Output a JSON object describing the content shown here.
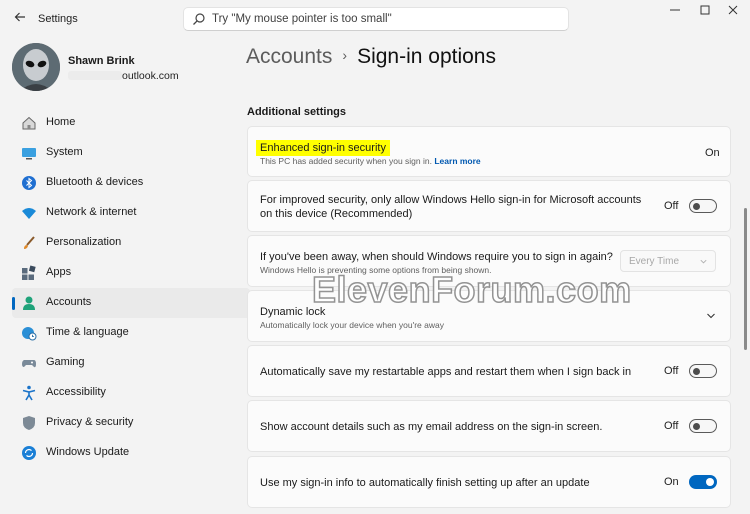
{
  "app": {
    "title": "Settings",
    "search_placeholder": "Try \"My mouse pointer is too small\"",
    "window_controls": [
      "minimize",
      "maximize",
      "close"
    ]
  },
  "profile": {
    "name": "Shawn Brink",
    "email_suffix": "outlook.com"
  },
  "nav": {
    "items": [
      {
        "label": "Home",
        "icon": "home-icon",
        "active": false
      },
      {
        "label": "System",
        "icon": "system-icon",
        "active": false
      },
      {
        "label": "Bluetooth & devices",
        "icon": "bluetooth-icon",
        "active": false
      },
      {
        "label": "Network & internet",
        "icon": "wifi-icon",
        "active": false
      },
      {
        "label": "Personalization",
        "icon": "brush-icon",
        "active": false
      },
      {
        "label": "Apps",
        "icon": "apps-icon",
        "active": false
      },
      {
        "label": "Accounts",
        "icon": "accounts-icon",
        "active": true
      },
      {
        "label": "Time & language",
        "icon": "globe-clock-icon",
        "active": false
      },
      {
        "label": "Gaming",
        "icon": "gamepad-icon",
        "active": false
      },
      {
        "label": "Accessibility",
        "icon": "accessibility-icon",
        "active": false
      },
      {
        "label": "Privacy & security",
        "icon": "shield-icon",
        "active": false
      },
      {
        "label": "Windows Update",
        "icon": "update-icon",
        "active": false
      }
    ]
  },
  "breadcrumb": {
    "parent": "Accounts",
    "separator": "›",
    "current": "Sign-in options"
  },
  "section": {
    "heading": "Additional settings"
  },
  "settings": {
    "enhanced": {
      "title": "Enhanced sign-in security",
      "subtitle": "This PC has added security when you sign in.",
      "link": "Learn more",
      "state": "On"
    },
    "hello_only": {
      "title": "For improved security, only allow Windows Hello sign-in for Microsoft accounts on this device (Recommended)",
      "state": "Off",
      "toggle_on": false
    },
    "away": {
      "title": "If you've been away, when should Windows require you to sign in again?",
      "subtitle": "Windows Hello is preventing some options from being shown.",
      "dropdown_value": "Every Time"
    },
    "dynamic_lock": {
      "title": "Dynamic lock",
      "subtitle": "Automatically lock your device when you're away"
    },
    "restart_apps": {
      "title": "Automatically save my restartable apps and restart them when I sign back in",
      "state": "Off",
      "toggle_on": false
    },
    "account_details": {
      "title": "Show account details such as my email address on the sign-in screen.",
      "state": "Off",
      "toggle_on": false
    },
    "signin_info": {
      "title": "Use my sign-in info to automatically finish setting up after an update",
      "state": "On",
      "toggle_on": true
    }
  },
  "watermark": "ElevenForum.com",
  "colors": {
    "accent": "#0067c0",
    "highlight": "#ffff00",
    "link": "#0058b0"
  }
}
